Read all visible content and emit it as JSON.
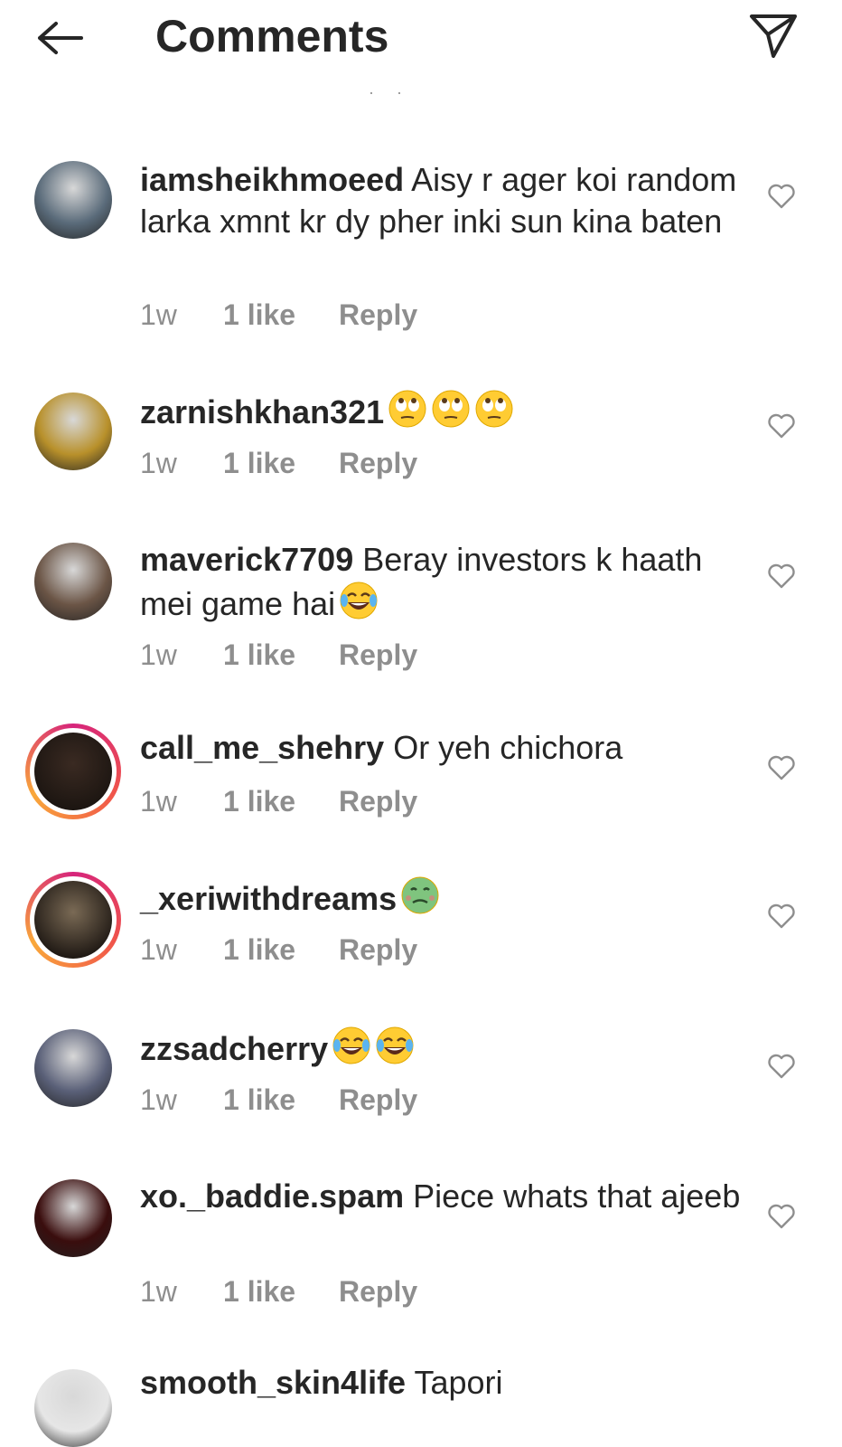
{
  "header": {
    "title": "Comments"
  },
  "comments": [
    {
      "username": "iamsheikhmoeed",
      "text": "Aisy r ager koi random larka  xmnt kr dy pher inki sun kina baten",
      "time": "1w",
      "likes": "1 like",
      "reply": "Reply",
      "avatar_color": "#5a6b7a",
      "ring": false,
      "emojis": []
    },
    {
      "username": "zarnishkhan321",
      "text": "",
      "time": "1w",
      "likes": "1 like",
      "reply": "Reply",
      "avatar_color": "#b8902a",
      "ring": false,
      "emojis": [
        "face-with-rolling-eyes",
        "face-with-rolling-eyes",
        "face-with-rolling-eyes"
      ]
    },
    {
      "username": "maverick7709",
      "text": "Beray investors k haath mei game hai",
      "time": "1w",
      "likes": "1 like",
      "reply": "Reply",
      "avatar_color": "#6b5546",
      "ring": false,
      "emojis": [
        "face-with-tears-of-joy"
      ]
    },
    {
      "username": "call_me_shehry",
      "text": "Or yeh chichora",
      "time": "1w",
      "likes": "1 like",
      "reply": "Reply",
      "avatar_color": "#3a2a22",
      "ring": true,
      "emojis": []
    },
    {
      "username": "_xeriwithdreams",
      "text": "",
      "time": "1w",
      "likes": "1 like",
      "reply": "Reply",
      "avatar_color": "#7a6a55",
      "ring": true,
      "emojis": [
        "nauseated-face"
      ]
    },
    {
      "username": "zzsadcherry",
      "text": "",
      "time": "1w",
      "likes": "1 like",
      "reply": "Reply",
      "avatar_color": "#5a6078",
      "ring": false,
      "emojis": [
        "face-with-tears-of-joy",
        "face-with-tears-of-joy"
      ]
    },
    {
      "username": "xo._baddie.spam",
      "text": "Piece whats that ajeeb",
      "time": "1w",
      "likes": "1 like",
      "reply": "Reply",
      "avatar_color": "#3a0d0d",
      "ring": false,
      "emojis": []
    },
    {
      "username": "smooth_skin4life",
      "text": "Tapori",
      "time": "",
      "likes": "",
      "reply": "",
      "avatar_color": "#e6e6e6",
      "ring": false,
      "emojis": []
    }
  ],
  "colors": {
    "text": "#262626",
    "secondary": "#8e8e8e",
    "ring_gradient": [
      "#d6247b",
      "#f0554a",
      "#f9a83a"
    ]
  }
}
